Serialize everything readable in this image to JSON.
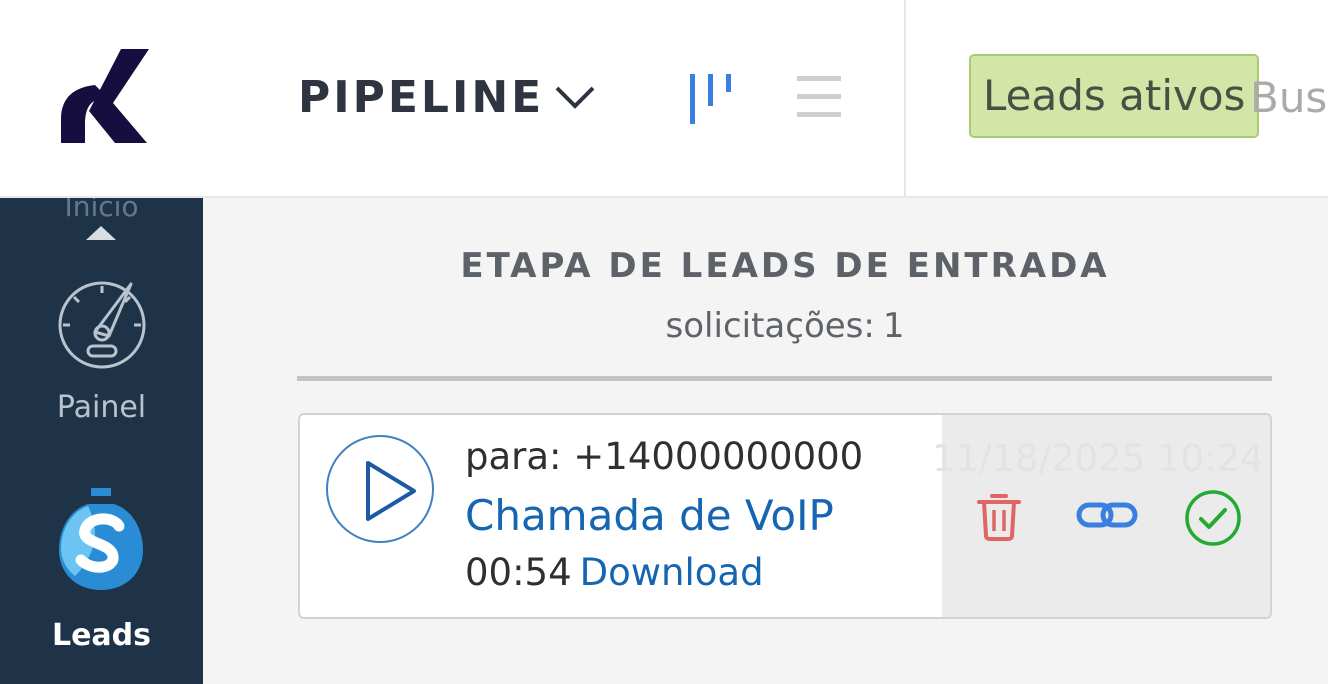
{
  "header": {
    "pipeline_title": "PIPELINE",
    "active_filter": "Leads ativos",
    "search_placeholder": "Buscar"
  },
  "sidebar": {
    "previous_item_label": "Início",
    "items": [
      {
        "label": "Painel",
        "icon": "speedometer-icon"
      },
      {
        "label": "Leads",
        "icon": "money-bag-icon",
        "active": true
      }
    ]
  },
  "stage": {
    "title": "ETAPA DE LEADS DE ENTRADA",
    "count_label": "solicitações:",
    "count_value": "1"
  },
  "leads": [
    {
      "to": "para: +14000000000",
      "type": "Chamada de VoIP",
      "duration": "00:54",
      "download_label": "Download",
      "date": "11/18/2025 10:24"
    }
  ],
  "colors": {
    "sidebar_bg": "#1e3347",
    "link_blue": "#1565b0",
    "filter_chip_bg": "#d3e6a8",
    "delete_red": "#e06666",
    "confirm_green": "#22aa33"
  }
}
